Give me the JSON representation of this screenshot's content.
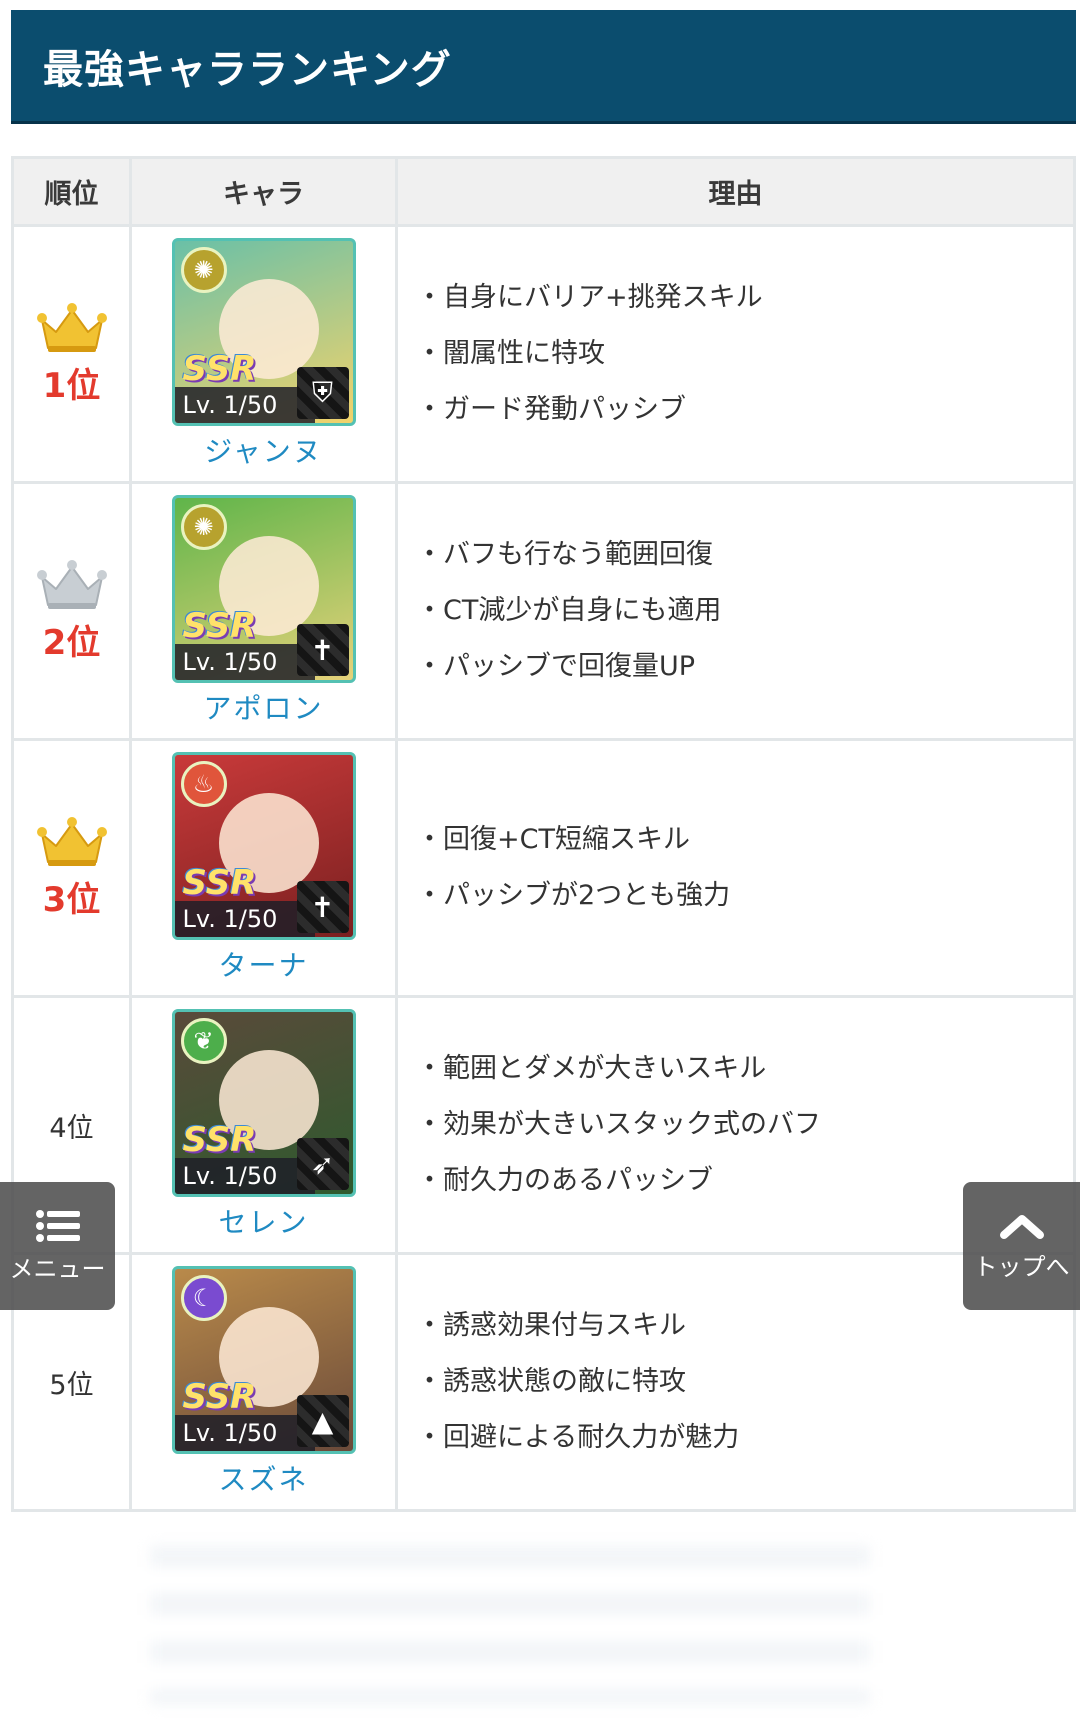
{
  "header": {
    "title": "最強キャラランキング"
  },
  "table": {
    "headers": {
      "rank": "順位",
      "character": "キャラ",
      "reason": "理由"
    },
    "rows": [
      {
        "rank": "1位",
        "crown": "gold",
        "level": "Lv. 1/50",
        "rarity": "SSR",
        "element_icon": "light-icon",
        "element_glyph": "✺",
        "role_icon": "shield-icon",
        "role_glyph": "⛨",
        "card_colors": [
          "#6ac0a7",
          "#f2d36b"
        ],
        "emblem_color": "#b7a22e",
        "name": "ジャンヌ",
        "reasons": [
          "自身にバリア+挑発スキル",
          "闇属性に特攻",
          "ガード発動パッシブ"
        ]
      },
      {
        "rank": "2位",
        "crown": "silver",
        "level": "Lv. 1/50",
        "rarity": "SSR",
        "element_icon": "light-icon",
        "element_glyph": "✺",
        "role_icon": "cross-icon",
        "role_glyph": "✝",
        "card_colors": [
          "#5fb54a",
          "#e6d27a"
        ],
        "emblem_color": "#b7a22e",
        "name": "アポロン",
        "reasons": [
          "バフも行なう範囲回復",
          "CT減少が自身にも適用",
          "パッシブで回復量UP"
        ]
      },
      {
        "rank": "3位",
        "crown": "gold",
        "level": "Lv. 1/50",
        "rarity": "SSR",
        "element_icon": "fire-icon",
        "element_glyph": "♨",
        "role_icon": "cross-icon",
        "role_glyph": "✝",
        "card_colors": [
          "#c93a3a",
          "#7a2020"
        ],
        "emblem_color": "#e0553b",
        "name": "ターナ",
        "reasons": [
          "回復+CT短縮スキル",
          "パッシブが2つとも強力"
        ]
      },
      {
        "rank": "4位",
        "crown": "none",
        "level": "Lv. 1/50",
        "rarity": "SSR",
        "element_icon": "wind-icon",
        "element_glyph": "❦",
        "role_icon": "bow-icon",
        "role_glyph": "➶",
        "card_colors": [
          "#5a4a3a",
          "#2e5a2e"
        ],
        "emblem_color": "#4dae4b",
        "name": "セレン",
        "reasons": [
          "範囲とダメが大きいスキル",
          "効果が大きいスタック式のバフ",
          "耐久力のあるパッシブ"
        ]
      },
      {
        "rank": "5位",
        "crown": "none",
        "level": "Lv. 1/50",
        "rarity": "SSR",
        "element_icon": "moon-icon",
        "element_glyph": "☾",
        "role_icon": "witch-hat-icon",
        "role_glyph": "▲",
        "card_colors": [
          "#b98a4a",
          "#6a4a3a"
        ],
        "emblem_color": "#7a4bd0",
        "name": "スズネ",
        "reasons": [
          "誘惑効果付与スキル",
          "誘惑状態の敵に特攻",
          "回避による耐久力が魅力"
        ]
      }
    ]
  },
  "buttons": {
    "menu_label": "メニュー",
    "top_label": "トップへ"
  },
  "colors": {
    "title_bar": "#0b4d6e",
    "rank_red": "#e33a2d",
    "name_blue": "#1f8ac2",
    "gold": "#f1c232",
    "silver": "#c8ced3"
  }
}
